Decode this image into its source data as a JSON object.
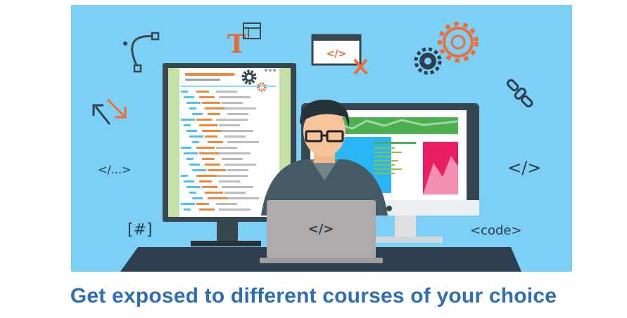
{
  "illustration": {
    "background_color": "#7dd0f5",
    "floating_labels": {
      "ellipsis_tag": "</...>",
      "close_tag": "</>",
      "hash_tag": "[#]",
      "code_tag": "<code>",
      "font_icon_letter": "T",
      "toolbar_tag": "</>",
      "laptop_tag": "</>"
    },
    "icons": [
      "bezier-curve-icon",
      "text-tool-icon",
      "browser-code-icon",
      "gears-icon",
      "arrows-icon",
      "chain-link-icon",
      "wrench-icon"
    ]
  },
  "caption": {
    "text": "Get exposed to different courses of your choice",
    "color": "#2e6fb3"
  }
}
